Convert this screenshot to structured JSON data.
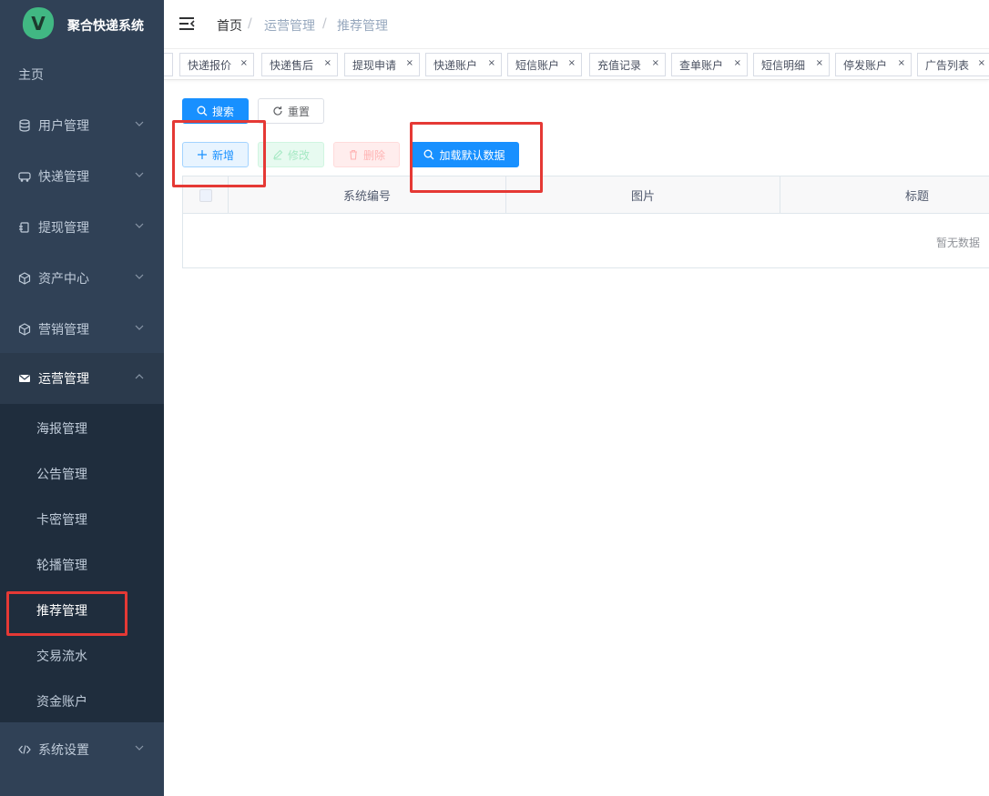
{
  "app": {
    "title": "聚合快递系统",
    "logo_letter": "V"
  },
  "colors": {
    "sidebar_bg": "#304156",
    "primary": "#1890ff",
    "annotation": "#e53935"
  },
  "sidebar": {
    "home": "主页",
    "menus": [
      {
        "label": "用户管理",
        "icon": "database-icon"
      },
      {
        "label": "快递管理",
        "icon": "truck-icon"
      },
      {
        "label": "提现管理",
        "icon": "cash-icon"
      },
      {
        "label": "资产中心",
        "icon": "cube-icon"
      },
      {
        "label": "营销管理",
        "icon": "cube-icon"
      },
      {
        "label": "运营管理",
        "icon": "mail-icon",
        "expanded": true
      },
      {
        "label": "系统设置",
        "icon": "code-icon"
      }
    ],
    "submenu": [
      "海报管理",
      "公告管理",
      "卡密管理",
      "轮播管理",
      "推荐管理",
      "交易流水",
      "资金账户"
    ],
    "active_submenu": "推荐管理"
  },
  "breadcrumb": {
    "home": "首页",
    "parent": "运营管理",
    "current": "推荐管理",
    "separator": "/"
  },
  "tags": [
    "快递报价",
    "快递售后",
    "提现申请",
    "快递账户",
    "短信账户",
    "充值记录",
    "查单账户",
    "短信明细",
    "停发账户",
    "广告列表"
  ],
  "toolbar": {
    "search": "搜索",
    "reset": "重置",
    "add": "新增",
    "edit": "修改",
    "delete": "删除",
    "load_default": "加载默认数据"
  },
  "table": {
    "columns": [
      "系统编号",
      "图片",
      "标题"
    ],
    "empty_text": "暂无数据"
  }
}
